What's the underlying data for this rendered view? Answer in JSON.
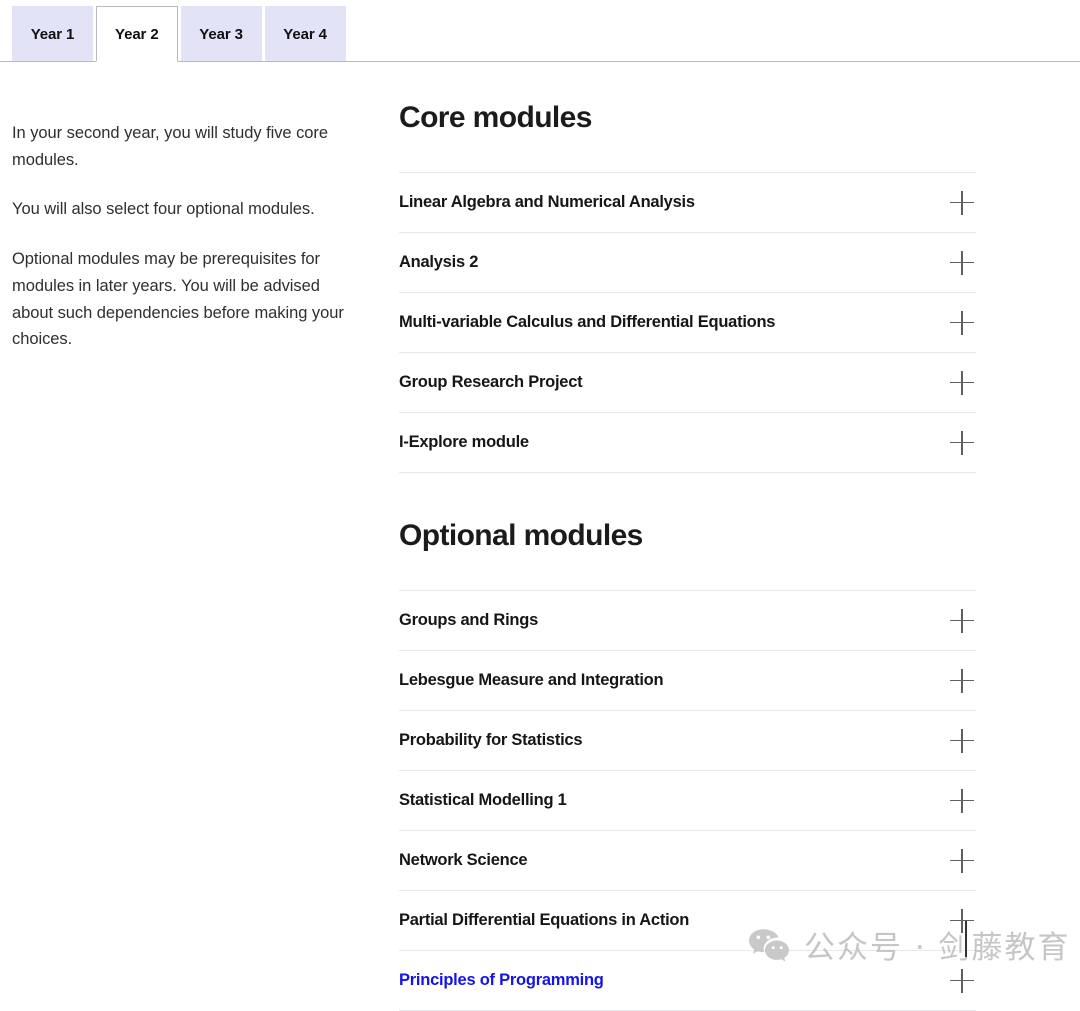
{
  "tabs": {
    "items": [
      {
        "label": "Year 1",
        "active": false
      },
      {
        "label": "Year 2",
        "active": true
      },
      {
        "label": "Year 3",
        "active": false
      },
      {
        "label": "Year 4",
        "active": false
      }
    ]
  },
  "intro": {
    "paragraphs": [
      "In your second year, you will study five core modules.",
      "You will also select four optional modules.",
      "Optional modules may be prerequisites for modules in later years. You will be advised about such dependencies before making your choices."
    ]
  },
  "sections": [
    {
      "title": "Core modules",
      "items": [
        {
          "label": "Linear Algebra and Numerical Analysis",
          "icon": "plus-icon",
          "highlighted": false
        },
        {
          "label": "Analysis 2",
          "icon": "plus-icon",
          "highlighted": false
        },
        {
          "label": "Multi-variable Calculus and Differential Equations",
          "icon": "plus-icon",
          "highlighted": false
        },
        {
          "label": "Group Research Project",
          "icon": "plus-icon",
          "highlighted": false
        },
        {
          "label": "I-Explore module",
          "icon": "plus-icon",
          "highlighted": false
        }
      ]
    },
    {
      "title": "Optional modules",
      "items": [
        {
          "label": "Groups and Rings",
          "icon": "plus-icon",
          "highlighted": false
        },
        {
          "label": "Lebesgue Measure and Integration",
          "icon": "plus-icon",
          "highlighted": false
        },
        {
          "label": "Probability for Statistics",
          "icon": "plus-icon",
          "highlighted": false
        },
        {
          "label": "Statistical Modelling 1",
          "icon": "plus-icon",
          "highlighted": false
        },
        {
          "label": "Network Science",
          "icon": "plus-icon",
          "highlighted": false
        },
        {
          "label": "Partial Differential Equations in Action",
          "icon": "plus-icon",
          "highlighted": false
        },
        {
          "label": "Principles of Programming",
          "icon": "plus-icon",
          "highlighted": true
        }
      ]
    }
  ],
  "watermark": {
    "icon": "wechat-icon",
    "text": "公众号 · 剑藤教育"
  },
  "colors": {
    "tab_inactive_bg": "#e3e3f7",
    "tab_active_bg": "#ffffff",
    "tab_border": "#b9b9c2",
    "link": "#1414e6",
    "separator": "#e6e8ec",
    "heading": "#1b1b1b",
    "watermark": "#c6c6c6"
  }
}
